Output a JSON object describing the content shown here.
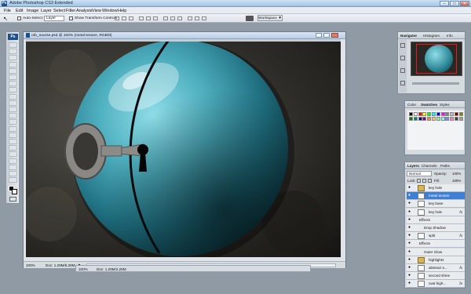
{
  "window": {
    "title": "Adobe Photoshop CS3 Extended",
    "controls": {
      "minimize": "–",
      "maximize": "□",
      "close": "✕"
    }
  },
  "menu": [
    "File",
    "Edit",
    "Image",
    "Layer",
    "Select",
    "Filter",
    "Analysis",
    "View",
    "Window",
    "Help"
  ],
  "options_bar": {
    "auto_select_label": "Auto-Select:",
    "auto_select_value": "Layer",
    "show_transform_label": "Show Transform Controls",
    "workspace_label": "Workspace ▼"
  },
  "toolbox": {
    "logo": "Ps",
    "tools": [
      "move-tool",
      "marquee-tool",
      "lasso-tool",
      "quick-select-tool",
      "crop-tool",
      "slice-tool",
      "healing-tool",
      "brush-tool",
      "clone-stamp-tool",
      "history-brush-tool",
      "eraser-tool",
      "gradient-tool",
      "blur-tool",
      "dodge-tool",
      "pen-tool",
      "type-tool",
      "path-select-tool",
      "shape-tool",
      "notes-tool",
      "eyedropper-tool",
      "hand-tool",
      "zoom-tool"
    ]
  },
  "document": {
    "tab_title": "orb_nourse.psd @ 100% (metal texture, RGB/8)",
    "zoom": "100%",
    "doc_size": "Doc: 1.29M/6.29M"
  },
  "second_status": {
    "zoom": "100%",
    "doc_size": "Doc: 1.29M/2.29M"
  },
  "navigator_panel": {
    "tabs": [
      "Navigator",
      "Histogram",
      "Info"
    ]
  },
  "color_panel": {
    "tabs": [
      "Color",
      "Swatches",
      "Styles"
    ],
    "swatches": [
      "#000000",
      "#ffffff",
      "#ff0000",
      "#ffff00",
      "#00ff00",
      "#00ffff",
      "#0000ff",
      "#ff00ff",
      "#7f7f7f",
      "#c0c0c0",
      "#800000",
      "#808000",
      "#008000",
      "#008080",
      "#000080",
      "#800080",
      "#ff8040",
      "#ffc080",
      "#80ff80",
      "#80ffff",
      "#8080ff",
      "#ff80c0",
      "#404040",
      "#a0a0a0"
    ]
  },
  "layers_panel": {
    "tabs": [
      "Layers",
      "Channels",
      "Paths"
    ],
    "blend_mode": "Normal",
    "opacity_label": "Opacity:",
    "opacity_value": "100%",
    "lock_label": "Lock:",
    "fill_label": "Fill:",
    "fill_value": "100%",
    "layers": [
      {
        "name": "key hole",
        "type": "group"
      },
      {
        "name": "metal texture",
        "type": "layer",
        "selected": true
      },
      {
        "name": "key base",
        "type": "layer"
      },
      {
        "name": "key hole",
        "type": "layer",
        "fx": "fx"
      },
      {
        "name": "Effects",
        "type": "effects"
      },
      {
        "name": "Drop Shadow",
        "type": "effect"
      },
      {
        "name": "split",
        "type": "layer",
        "fx": "fx"
      },
      {
        "name": "Effects",
        "type": "effects"
      },
      {
        "name": "Outer Glow",
        "type": "effect"
      },
      {
        "name": "highlights",
        "type": "group"
      },
      {
        "name": "abstract s...",
        "type": "layer",
        "fx": "fx"
      },
      {
        "name": "second shine",
        "type": "layer"
      },
      {
        "name": "oval high...",
        "type": "layer",
        "fx": "fx"
      }
    ]
  },
  "colors": {
    "selected_layer": "#3d7fd6",
    "orb_light": "#86d3df",
    "orb_dark": "#0e3a45"
  }
}
